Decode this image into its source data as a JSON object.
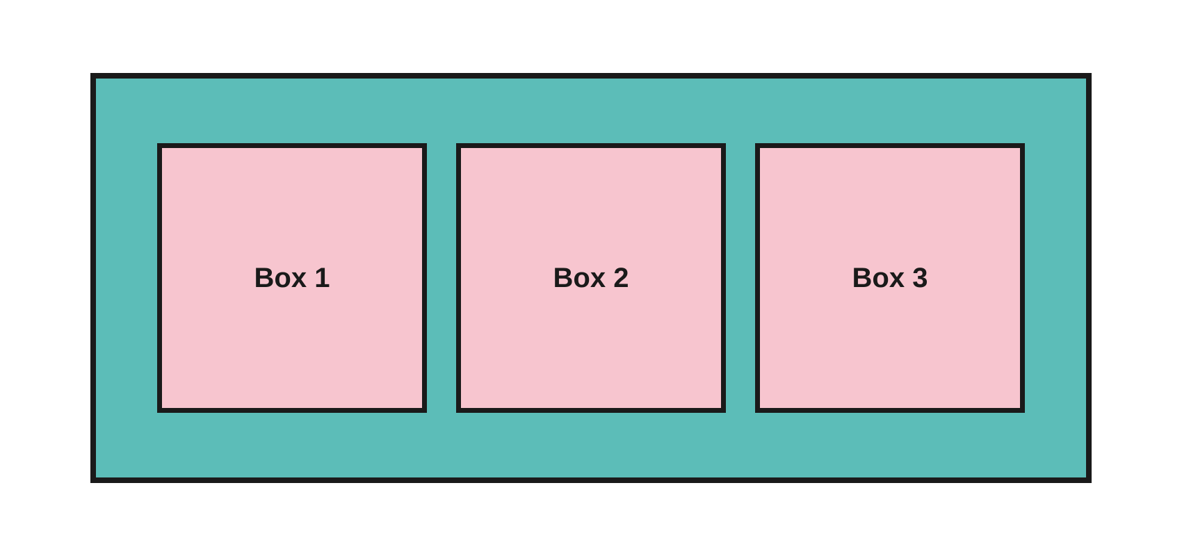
{
  "boxes": [
    {
      "label": "Box 1"
    },
    {
      "label": "Box 2"
    },
    {
      "label": "Box 3"
    }
  ],
  "colors": {
    "container_bg": "#5cbdb8",
    "box_bg": "#f7c5cf",
    "border": "#1a1a1a",
    "text": "#1a1a1a"
  }
}
